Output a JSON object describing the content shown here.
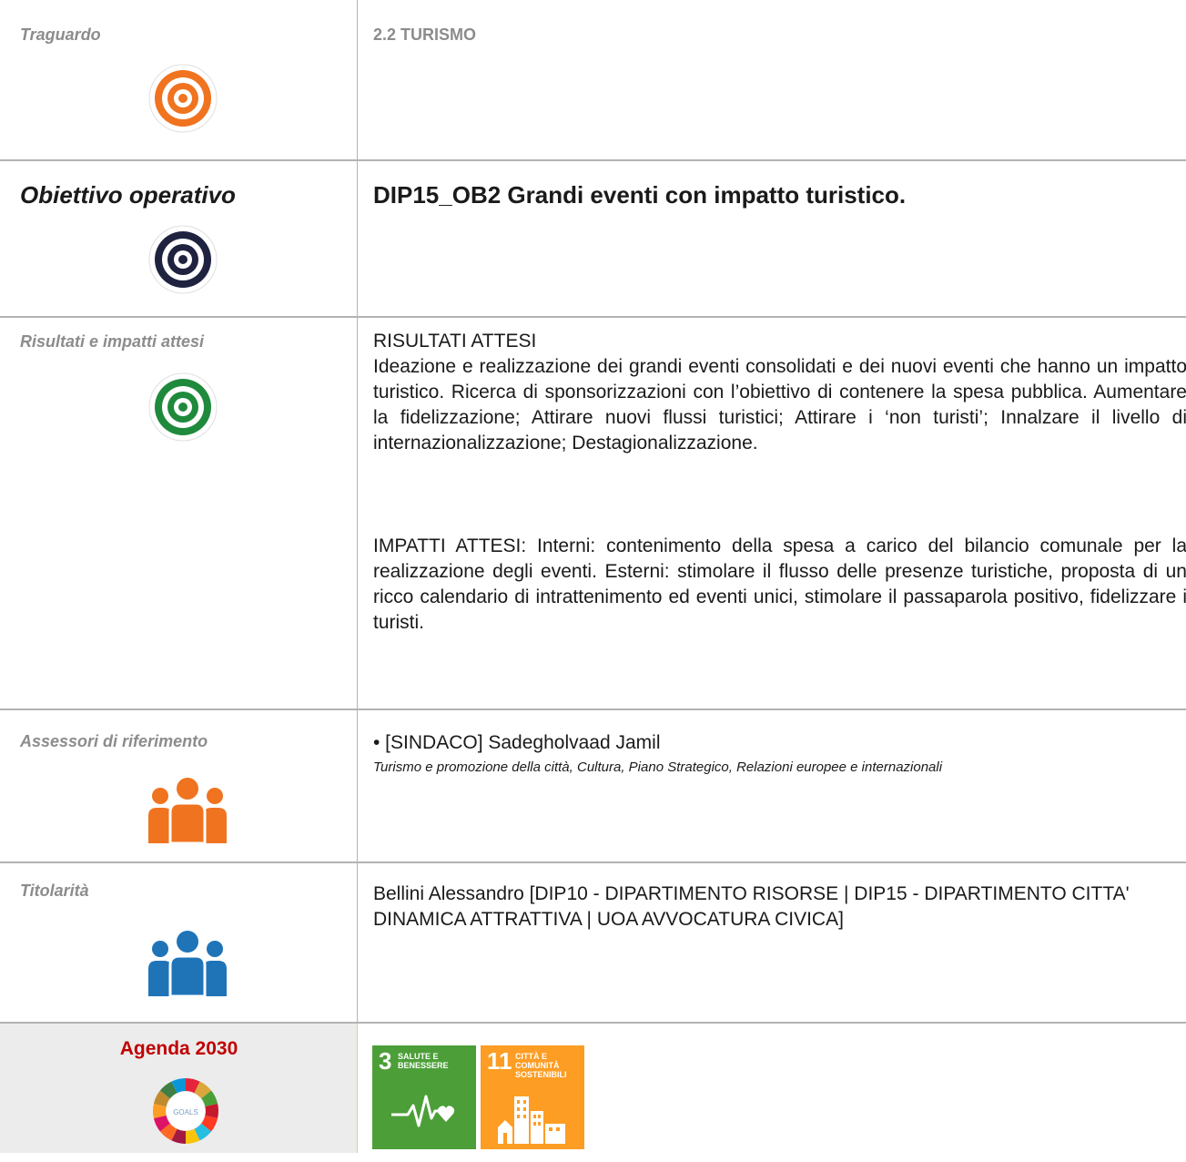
{
  "traguardo": {
    "label": "Traguardo",
    "value": "2.2 TURISMO"
  },
  "obiettivo": {
    "label": "Obiettivo operativo",
    "value": "DIP15_OB2 Grandi eventi con impatto turistico."
  },
  "risultati": {
    "label": "Risultati e impatti attesi",
    "heading": "RISULTATI ATTESI",
    "body": "Ideazione e realizzazione dei grandi eventi consolidati e dei nuovi eventi che hanno un impatto turistico. Ricerca di sponsorizzazioni con l’obiettivo di contenere la spesa pubblica. Aumentare la fidelizzazione; Attirare nuovi flussi turistici; Attirare i ‘non turisti’; Innalzare il livello di internazionalizzazione; Destagionalizzazione.",
    "impatti": "IMPATTI ATTESI: Interni: contenimento della spesa a carico del bilancio comunale per la realizzazione degli eventi. Esterni: stimolare il flusso delle presenze turistiche, proposta di un ricco calendario di intrattenimento ed eventi unici, stimolare il passaparola positivo, fidelizzare i turisti."
  },
  "assessori": {
    "label": "Assessori di riferimento",
    "name": "• [SINDACO] Sadegholvaad Jamil",
    "deleghe": "Turismo e promozione della città, Cultura, Piano Strategico, Relazioni europee e internazionali"
  },
  "titolarita": {
    "label": "Titolarità",
    "value": "Bellini Alessandro [DIP10 - DIPARTIMENTO RISORSE | DIP15 - DIPARTIMENTO CITTA' DINAMICA ATTRATTIVA | UOA AVVOCATURA CIVICA]"
  },
  "agenda": {
    "label": "Agenda 2030",
    "logo_text": "GOALS",
    "goals": [
      {
        "number": "3",
        "title_line1": "SALUTE E",
        "title_line2": "BENESSERE",
        "color": "#4c9f38"
      },
      {
        "number": "11",
        "title_line1": "CITTÀ E COMUNITÀ",
        "title_line2": "SOSTENIBILI",
        "color": "#fd9d24"
      }
    ]
  },
  "colors": {
    "traguardo_icon": "#f07320",
    "obiettivo_icon": "#1f2340",
    "risultati_icon": "#1f8a3c",
    "assessori_icon": "#f07320",
    "titolarita_icon": "#1f74b8",
    "agenda_label": "#c00000"
  }
}
